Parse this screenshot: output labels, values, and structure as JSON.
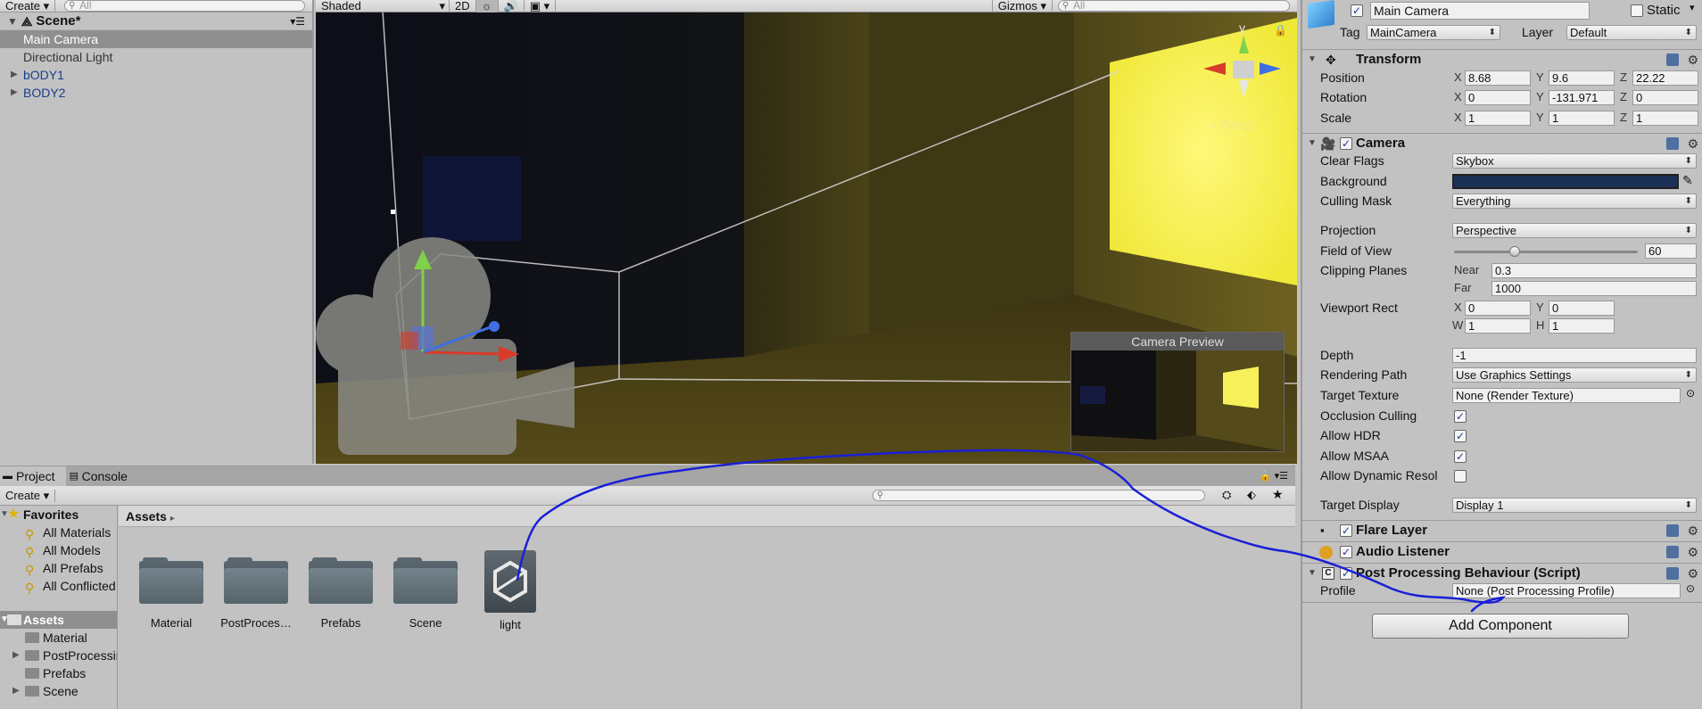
{
  "hierarchy": {
    "create_label": "Create",
    "search_placeholder": "All",
    "scene_name": "Scene*",
    "items": [
      {
        "label": "Main Camera"
      },
      {
        "label": "Directional Light"
      },
      {
        "label": "bODY1"
      },
      {
        "label": "BODY2"
      }
    ]
  },
  "scene_toolbar": {
    "shading_mode": "Shaded",
    "mode_2d": "2D",
    "gizmos_label": "Gizmos",
    "search_placeholder": "All"
  },
  "scene_view": {
    "gizmo_axis_label": "y",
    "projection_label": "< Persp",
    "camera_preview_title": "Camera Preview"
  },
  "project": {
    "tabs": [
      {
        "label": "Project"
      },
      {
        "label": "Console"
      }
    ],
    "create_label": "Create",
    "favorites_title": "Favorites",
    "favorites": [
      {
        "label": "All Materials"
      },
      {
        "label": "All Models"
      },
      {
        "label": "All Prefabs"
      },
      {
        "label": "All Conflicted"
      }
    ],
    "assets_title": "Assets",
    "asset_tree": [
      {
        "label": "Material"
      },
      {
        "label": "PostProcessing"
      },
      {
        "label": "Prefabs"
      },
      {
        "label": "Scene"
      }
    ],
    "breadcrumb": "Assets",
    "grid": [
      {
        "label": "Material"
      },
      {
        "label": "PostProces…"
      },
      {
        "label": "Prefabs"
      },
      {
        "label": "Scene"
      },
      {
        "label": "light"
      }
    ]
  },
  "inspector": {
    "object_name": "Main Camera",
    "static_label": "Static",
    "tag_label": "Tag",
    "tag_value": "MainCamera",
    "layer_label": "Layer",
    "layer_value": "Default",
    "transform": {
      "title": "Transform",
      "position_label": "Position",
      "position": {
        "x": "8.68",
        "y": "9.6",
        "z": "22.22"
      },
      "rotation_label": "Rotation",
      "rotation": {
        "x": "0",
        "y": "-131.971",
        "z": "0"
      },
      "scale_label": "Scale",
      "scale": {
        "x": "1",
        "y": "1",
        "z": "1"
      }
    },
    "camera": {
      "title": "Camera",
      "clear_flags_label": "Clear Flags",
      "clear_flags": "Skybox",
      "background_label": "Background",
      "background_color": "#1c2f55",
      "culling_mask_label": "Culling Mask",
      "culling_mask": "Everything",
      "projection_label": "Projection",
      "projection": "Perspective",
      "fov_label": "Field of View",
      "fov": "60",
      "fov_fraction": 0.33,
      "clipping_label": "Clipping Planes",
      "near_label": "Near",
      "near": "0.3",
      "far_label": "Far",
      "far": "1000",
      "viewport_label": "Viewport Rect",
      "vp_x": "0",
      "vp_y": "0",
      "vp_w": "1",
      "vp_h": "1",
      "depth_label": "Depth",
      "depth": "-1",
      "rendering_path_label": "Rendering Path",
      "rendering_path": "Use Graphics Settings",
      "target_texture_label": "Target Texture",
      "target_texture": "None (Render Texture)",
      "occlusion_label": "Occlusion Culling",
      "hdr_label": "Allow HDR",
      "msaa_label": "Allow MSAA",
      "dynamic_label": "Allow Dynamic Resol",
      "target_display_label": "Target Display",
      "target_display": "Display 1"
    },
    "flare_layer": "Flare Layer",
    "audio_listener": "Audio Listener",
    "post_processing": {
      "title": "Post Processing Behaviour (Script)",
      "profile_label": "Profile",
      "profile": "None (Post Processing Profile)"
    },
    "add_component": "Add Component"
  }
}
